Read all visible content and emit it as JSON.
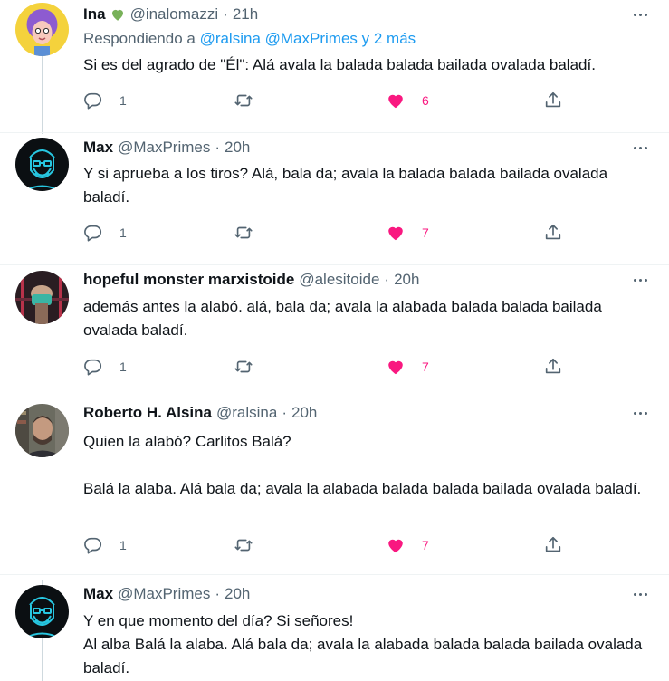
{
  "tweets": [
    {
      "name": "Ina",
      "handle": "@inalomazzi",
      "time": "21h",
      "replying_prefix": "Respondiendo a",
      "replying_to": [
        "@ralsina",
        "@MaxPrimes"
      ],
      "replying_more": "y 2 más",
      "paragraphs": [
        "Si es del agrado de \"Él\": Alá avala la balada balada bailada ovalada baladí."
      ],
      "replies": "1",
      "likes": "6"
    },
    {
      "name": "Max",
      "handle": "@MaxPrimes",
      "time": "20h",
      "paragraphs": [
        "Y si aprueba a los tiros? Alá, bala da; avala la balada balada bailada ovalada baladí."
      ],
      "replies": "1",
      "likes": "7"
    },
    {
      "name": "hopeful monster marxistoide",
      "handle": "@alesitoide",
      "time": "20h",
      "paragraphs": [
        "además antes la alabó. alá, bala da; avala la alabada balada balada bailada ovalada baladí."
      ],
      "replies": "1",
      "likes": "7"
    },
    {
      "name": "Roberto H. Alsina",
      "handle": "@ralsina",
      "time": "20h",
      "paragraphs": [
        "Quien la alabó? Carlitos Balá?",
        "Balá la alaba. Alá bala da; avala la alabada balada balada bailada ovalada baladí."
      ],
      "replies": "1",
      "likes": "7"
    },
    {
      "name": "Max",
      "handle": "@MaxPrimes",
      "time": "20h",
      "paragraphs": [
        "Y en que momento del día? Si señores!",
        "Al alba Balá la alaba. Alá bala da; avala la alabada balada balada bailada ovalada baladí."
      ]
    }
  ],
  "separator": "·",
  "colors": {
    "text": "#0f1419",
    "muted": "#536471",
    "link": "#1d9bf0",
    "like": "#f91880",
    "border": "#eff3f4",
    "thread": "#cfd9de"
  }
}
